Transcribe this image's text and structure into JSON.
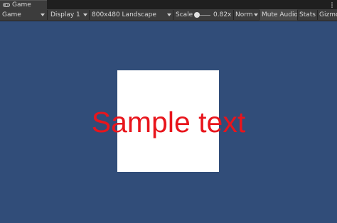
{
  "tab": {
    "title": "Game",
    "icon": "gamepad-icon"
  },
  "toolbar": {
    "view_mode": "Game",
    "display": "Display 1",
    "resolution": "800x480 Landscape",
    "scale_label": "Scale",
    "scale_value": "0.82x",
    "play_mode": "Norm",
    "mute_audio": "Mute Audio",
    "stats": "Stats",
    "gizmos": "Gizmo"
  },
  "game": {
    "background_color": "#314d79",
    "square_color": "#ffffff",
    "text_color": "#e8151c",
    "sample_text": "Sample text"
  }
}
